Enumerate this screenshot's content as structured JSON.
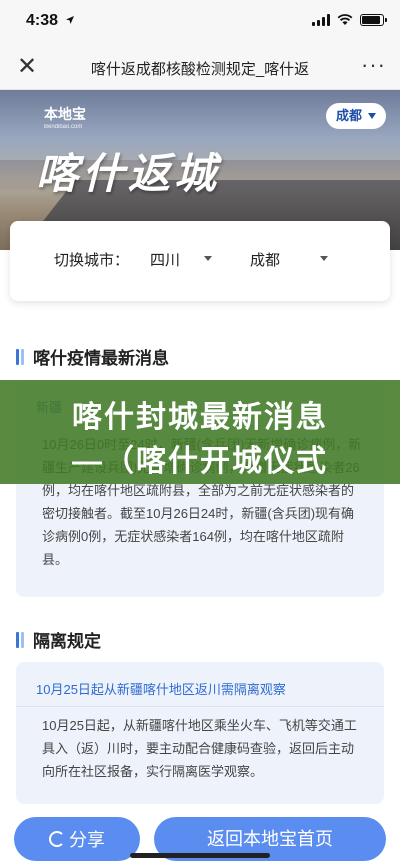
{
  "status_bar": {
    "time": "4:38",
    "location_arrow": "location-arrow-icon"
  },
  "nav": {
    "close_icon": "close-icon",
    "title": "喀什返成都核酸检测规定_喀什返",
    "more_icon": "more-icon"
  },
  "banner": {
    "logo_main": "本地宝",
    "logo_sub": "Bendibao.com",
    "title": "喀什返城",
    "city": "成都"
  },
  "selector": {
    "label": "切换城市：",
    "province": "四川",
    "city": "成都"
  },
  "sections": [
    {
      "title": "喀什疫情最新消息",
      "headline": "新疆",
      "body": "10月26日0时至24时，新疆(含兵团)无新增确诊病例，新疆生产建设兵团)无新增确诊病例，新增无症状感染者26例，均在喀什地区疏附县，全部为之前无症状感染者的密切接触者。截至10月26日24时，新疆(含兵团)现有确诊病例0例，无症状感染者164例，均在喀什地区疏附县。"
    },
    {
      "title": "隔离规定",
      "headline": "10月25日起从新疆喀什地区返川需隔离观察",
      "body": "10月25日起，从新疆喀什地区乘坐火车、飞机等交通工具入（返）川时，要主动配合健康码查验，返回后主动向所在社区报备，实行隔离医学观察。"
    }
  ],
  "overlay": {
    "line1": "喀什封城最新消息",
    "line2": "—（喀什开城仪式"
  },
  "buttons": {
    "share": "分享",
    "back_home": "返回本地宝首页"
  },
  "colors": {
    "accent": "#2e6bd1",
    "button": "#5b8df0",
    "overlay": "#427a26",
    "bar_dark": "#3d74d8",
    "bar_light": "#9fc0f5"
  }
}
